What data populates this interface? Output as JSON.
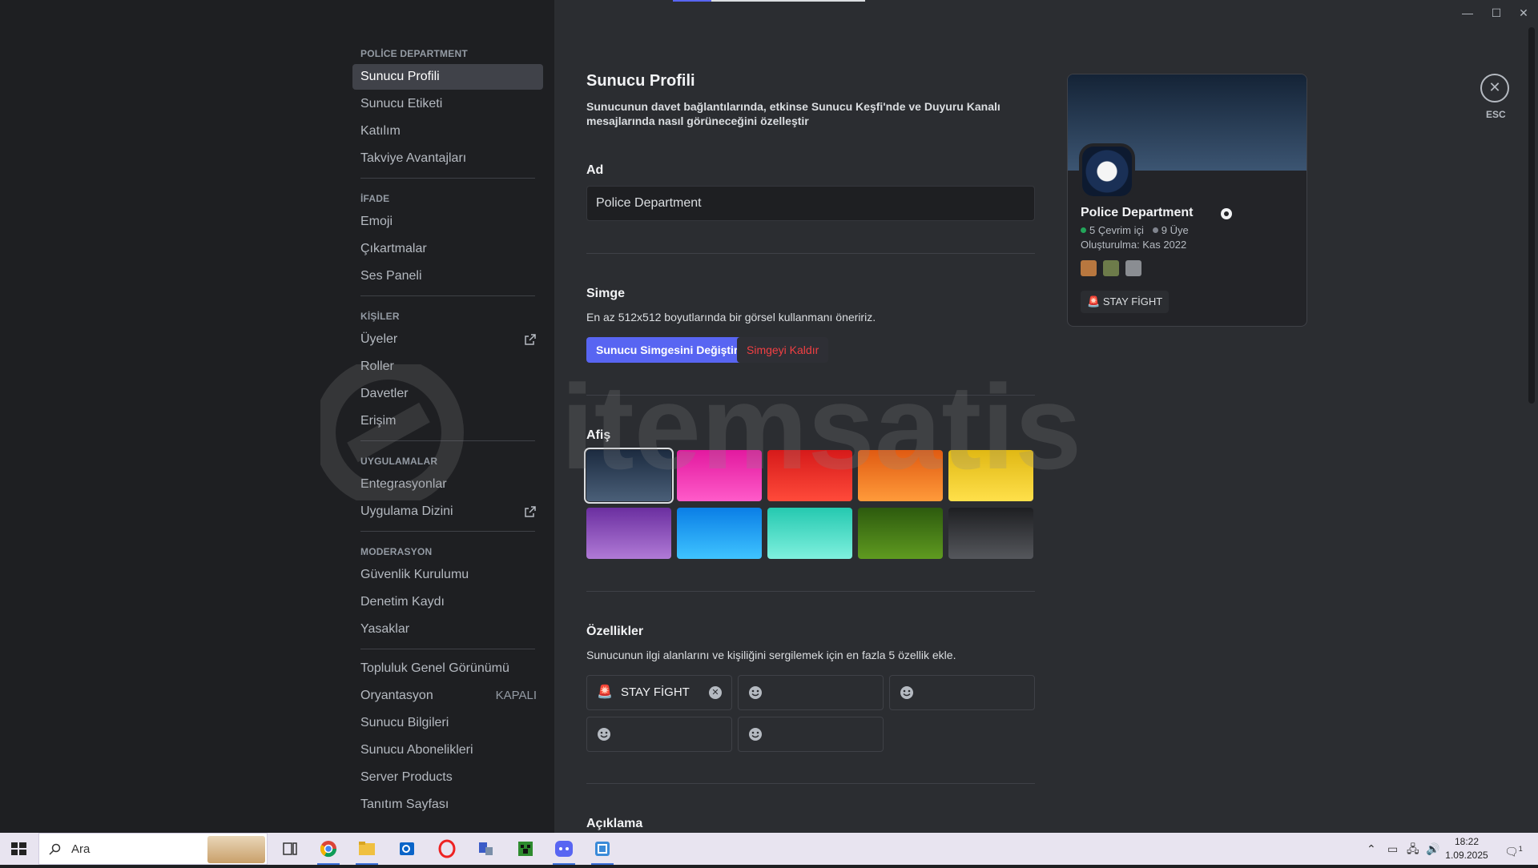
{
  "window": {
    "minimize": "—",
    "maximize": "☐",
    "close": "✕"
  },
  "sidebar": {
    "sections": [
      {
        "header": "POLİCE DEPARTMENT",
        "items": [
          {
            "label": "Sunucu Profili",
            "active": true
          },
          {
            "label": "Sunucu Etiketi"
          },
          {
            "label": "Katılım"
          },
          {
            "label": "Takviye Avantajları"
          }
        ]
      },
      {
        "header": "İFADE",
        "items": [
          {
            "label": "Emoji"
          },
          {
            "label": "Çıkartmalar"
          },
          {
            "label": "Ses Paneli"
          }
        ]
      },
      {
        "header": "KİŞİLER",
        "items": [
          {
            "label": "Üyeler",
            "external": true
          },
          {
            "label": "Roller"
          },
          {
            "label": "Davetler"
          },
          {
            "label": "Erişim"
          }
        ]
      },
      {
        "header": "UYGULAMALAR",
        "items": [
          {
            "label": "Entegrasyonlar"
          },
          {
            "label": "Uygulama Dizini",
            "external": true
          }
        ]
      },
      {
        "header": "MODERASYON",
        "items": [
          {
            "label": "Güvenlik Kurulumu"
          },
          {
            "label": "Denetim Kaydı"
          },
          {
            "label": "Yasaklar"
          }
        ]
      },
      {
        "header": "",
        "items": [
          {
            "label": "Topluluk Genel Görünümü"
          },
          {
            "label": "Oryantasyon",
            "badge": "KAPALI"
          },
          {
            "label": "Sunucu Bilgileri"
          },
          {
            "label": "Sunucu Abonelikleri"
          },
          {
            "label": "Server Products"
          },
          {
            "label": "Tanıtım Sayfası"
          }
        ]
      }
    ]
  },
  "main": {
    "title": "Sunucu Profili",
    "subtitle": "Sunucunun davet bağlantılarında, etkinse Sunucu Keşfi'nde ve Duyuru Kanalı mesajlarında nasıl görüneceğini özelleştir",
    "name_label": "Ad",
    "name_value": "Police Department",
    "icon_label": "Simge",
    "icon_help": "En az 512x512 boyutlarında bir görsel kullanmanı öneririz.",
    "change_icon_button": "Sunucu Simgesini Değiştir",
    "remove_icon_button": "Simgeyi Kaldır",
    "banner_label": "Afiş",
    "banner_colors": [
      {
        "from": "#1c2b40",
        "to": "#4a5f78",
        "selected": true
      },
      {
        "from": "#e2199f",
        "to": "#ff5bc9"
      },
      {
        "from": "#d61a1a",
        "to": "#ff4a3a"
      },
      {
        "from": "#e05a12",
        "to": "#ff9a3a"
      },
      {
        "from": "#e0b814",
        "to": "#ffe04a"
      },
      {
        "from": "#6b2fa0",
        "to": "#b07ad6"
      },
      {
        "from": "#0a7ee6",
        "to": "#3fc4ff"
      },
      {
        "from": "#25c9b0",
        "to": "#7ff0de"
      },
      {
        "from": "#2d5a0e",
        "to": "#5f9a20"
      },
      {
        "from": "#1e1f22",
        "to": "#55575c"
      }
    ],
    "traits_label": "Özellikler",
    "traits_help": "Sunucunun ilgi alanlarını ve kişiliğini sergilemek için en fazla 5 özellik ekle.",
    "traits": [
      {
        "emoji": "🚨",
        "text": "STAY FİGHT"
      },
      {
        "emoji": "",
        "text": ""
      },
      {
        "emoji": "",
        "text": ""
      },
      {
        "emoji": "",
        "text": ""
      },
      {
        "emoji": "",
        "text": ""
      }
    ],
    "description_label": "Açıklama"
  },
  "preview": {
    "name": "Police Department",
    "online": "5 Çevrim içi",
    "members": "9 Üye",
    "created": "Oluşturulma: Kas 2022",
    "tag_emoji": "🚨",
    "tag_text": "STAY FİGHT",
    "online_color": "#23a55a",
    "members_color": "#80848e"
  },
  "esc": {
    "icon": "✕",
    "label": "ESC"
  },
  "taskbar": {
    "search_placeholder": "Ara",
    "time": "18:22",
    "date": "1.09.2025",
    "notification_count": "1"
  },
  "colors": {
    "accent": "#5865f2",
    "danger": "#f23f43"
  }
}
